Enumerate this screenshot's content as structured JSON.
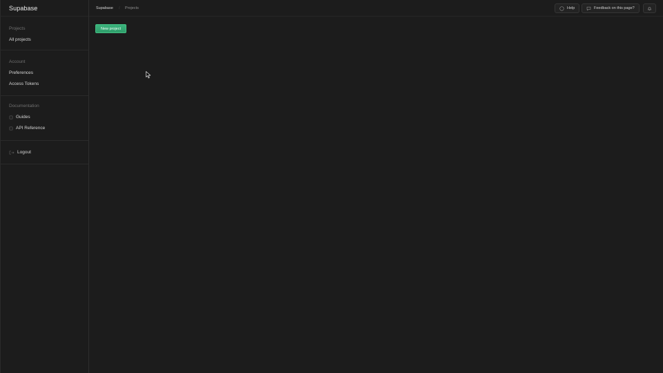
{
  "sidebar": {
    "brand": "Supabase",
    "sections": [
      {
        "heading": "Projects",
        "items": [
          {
            "label": "All projects"
          }
        ]
      },
      {
        "heading": "Account",
        "items": [
          {
            "label": "Preferences"
          },
          {
            "label": "Access Tokens"
          }
        ]
      },
      {
        "heading": "Documentation",
        "items": [
          {
            "label": "Guides",
            "icon": "book-icon"
          },
          {
            "label": "API Reference",
            "icon": "book-icon"
          }
        ]
      },
      {
        "heading": "",
        "items": [
          {
            "label": "Logout",
            "icon": "logout-icon"
          }
        ]
      }
    ]
  },
  "header": {
    "breadcrumb": {
      "root": "Supabase",
      "current": "Projects"
    },
    "help_label": "Help",
    "feedback_label": "Feedback on this page?",
    "icons": {
      "help": "help-circle-icon",
      "feedback": "message-icon",
      "notifications": "bell-icon"
    }
  },
  "main": {
    "new_project_label": "New project"
  },
  "colors": {
    "background": "#1c1c1c",
    "accent": "#3ecf8e",
    "muted_text": "#6f6f6f"
  }
}
